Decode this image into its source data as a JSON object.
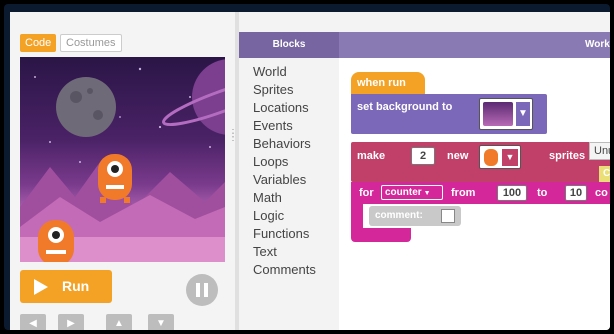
{
  "tabs": {
    "code": "Code",
    "costumes": "Costumes"
  },
  "controls": {
    "run_label": "Run"
  },
  "toolbox": {
    "header": "Blocks",
    "categories": [
      "World",
      "Sprites",
      "Locations",
      "Events",
      "Behaviors",
      "Loops",
      "Variables",
      "Math",
      "Logic",
      "Functions",
      "Text",
      "Comments"
    ]
  },
  "workspace": {
    "header": "Works",
    "when_run": "when run",
    "set_background": "set background to",
    "make": "make",
    "make_count": "2",
    "new": "new",
    "sprites": "sprites",
    "side_label": "Unu",
    "side_label2": "Ch",
    "for": "for",
    "counter_var": "counter",
    "from": "from",
    "from_value": "100",
    "to": "to",
    "to_value": "10",
    "count_cut": "co",
    "comment": "comment:"
  },
  "colors": {
    "accent": "#f3a226",
    "events_orange": "#f3a226",
    "sprites_purple": "#7c68b8",
    "loops_magenta": "#d4289a",
    "comment_gray": "#c9c9c9"
  }
}
